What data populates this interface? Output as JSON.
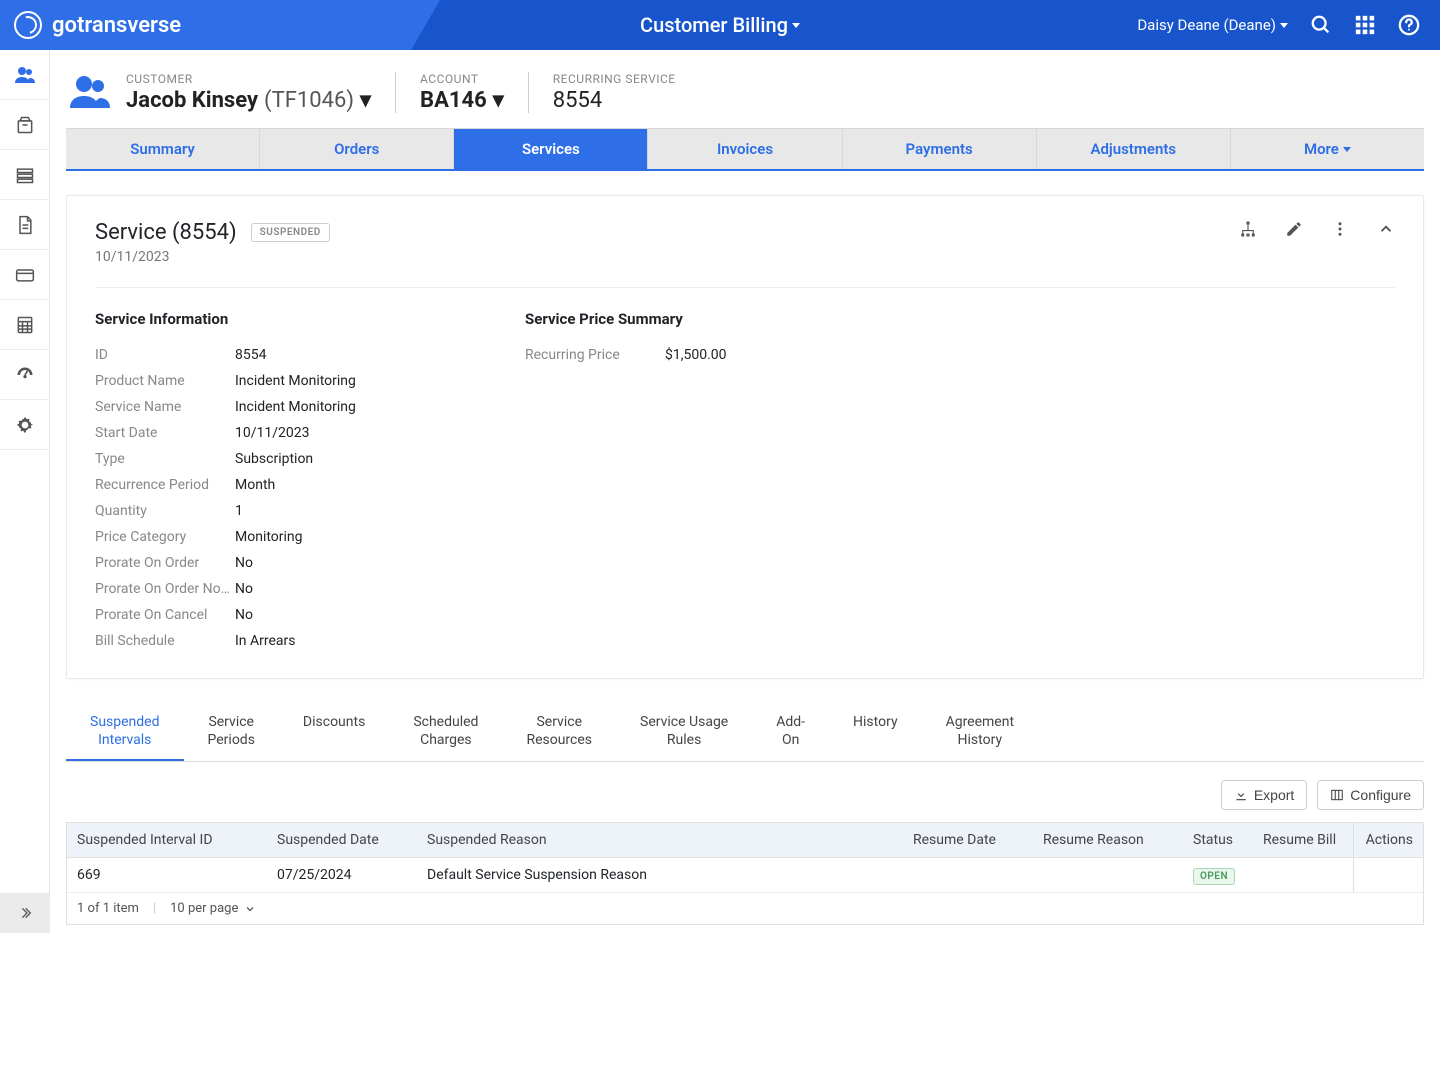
{
  "topbar": {
    "brand": "gotransverse",
    "section": "Customer Billing",
    "user": "Daisy Deane (Deane)"
  },
  "breadcrumb": {
    "customer_label": "CUSTOMER",
    "customer_name": "Jacob Kinsey",
    "customer_code": "(TF1046)",
    "account_label": "ACCOUNT",
    "account_value": "BA146",
    "service_label": "RECURRING SERVICE",
    "service_value": "8554"
  },
  "main_tabs": [
    "Summary",
    "Orders",
    "Services",
    "Invoices",
    "Payments",
    "Adjustments",
    "More"
  ],
  "main_tab_active": "Services",
  "card": {
    "title": "Service (8554)",
    "status_badge": "SUSPENDED",
    "subtitle": "10/11/2023"
  },
  "service_info": {
    "heading": "Service Information",
    "rows": [
      {
        "k": "ID",
        "v": "8554"
      },
      {
        "k": "Product Name",
        "v": "Incident Monitoring"
      },
      {
        "k": "Service Name",
        "v": "Incident Monitoring"
      },
      {
        "k": "Start Date",
        "v": "10/11/2023"
      },
      {
        "k": "Type",
        "v": "Subscription"
      },
      {
        "k": "Recurrence Period",
        "v": "Month"
      },
      {
        "k": "Quantity",
        "v": "1"
      },
      {
        "k": "Price Category",
        "v": "Monitoring"
      },
      {
        "k": "Prorate On Order",
        "v": "No"
      },
      {
        "k": "Prorate On Order No…",
        "v": "No"
      },
      {
        "k": "Prorate On Cancel",
        "v": "No"
      },
      {
        "k": "Bill Schedule",
        "v": "In Arrears"
      }
    ]
  },
  "price_summary": {
    "heading": "Service Price Summary",
    "rows": [
      {
        "k": "Recurring Price",
        "v": "$1,500.00"
      }
    ]
  },
  "sub_tabs": [
    {
      "l1": "Suspended",
      "l2": "Intervals"
    },
    {
      "l1": "Service",
      "l2": "Periods"
    },
    {
      "l1": "Discounts",
      "l2": ""
    },
    {
      "l1": "Scheduled",
      "l2": "Charges"
    },
    {
      "l1": "Service",
      "l2": "Resources"
    },
    {
      "l1": "Service Usage",
      "l2": "Rules"
    },
    {
      "l1": "Add-",
      "l2": "On"
    },
    {
      "l1": "History",
      "l2": ""
    },
    {
      "l1": "Agreement",
      "l2": "History"
    }
  ],
  "sub_tab_active": 0,
  "toolbar": {
    "export": "Export",
    "configure": "Configure"
  },
  "table": {
    "headers": {
      "id": "Suspended Interval ID",
      "date": "Suspended Date",
      "reason": "Suspended Reason",
      "resume_date": "Resume Date",
      "resume_reason": "Resume Reason",
      "status": "Status",
      "resume_bill": "Resume Bill",
      "actions": "Actions"
    },
    "rows": [
      {
        "id": "669",
        "date": "07/25/2024",
        "reason": "Default Service Suspension Reason",
        "resume_date": "",
        "resume_reason": "",
        "status": "OPEN",
        "resume_bill": ""
      }
    ],
    "footer_count": "1 of 1 item",
    "per_page": "10 per page"
  }
}
